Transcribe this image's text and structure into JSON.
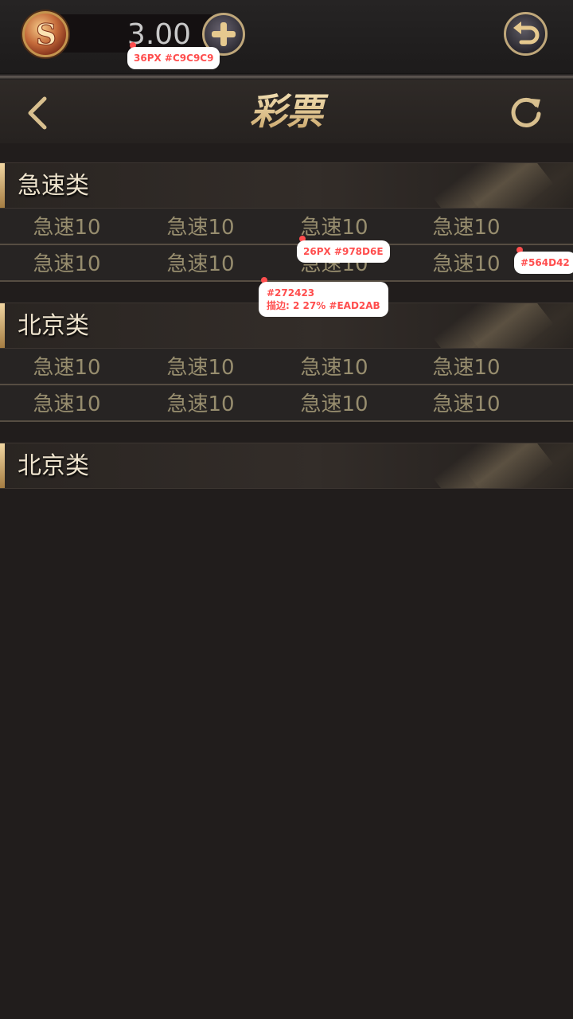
{
  "topbar": {
    "balance": "3.00",
    "coin_icon": "s-coin-icon",
    "add_icon": "plus-icon",
    "return_icon": "return-icon"
  },
  "header": {
    "title": "彩票",
    "back_icon": "chevron-left-icon",
    "refresh_icon": "refresh-icon"
  },
  "sections": [
    {
      "title": "急速类",
      "rows": [
        [
          "急速10",
          "急速10",
          "急速10",
          "急速10"
        ],
        [
          "急速10",
          "急速10",
          "急速10",
          "急速10"
        ]
      ]
    },
    {
      "title": "北京类",
      "rows": [
        [
          "急速10",
          "急速10",
          "急速10",
          "急速10"
        ],
        [
          "急速10",
          "急速10",
          "急速10",
          "急速10"
        ]
      ]
    },
    {
      "title": "北京类",
      "rows": []
    }
  ],
  "annotations": {
    "balance_spec": "36PX #C9C9C9",
    "cell_spec": "26PX #978D6E",
    "divider_spec": "#564D42",
    "row_bg_spec_line1": "#272423",
    "row_bg_spec_line2": "描边: 2 27% #EAD2AB"
  },
  "colors": {
    "page_bg": "#211d1c",
    "row_bg": "#272423",
    "divider": "#564d42",
    "cell_text": "#978d6e",
    "balance_text": "#c9c9c9",
    "accent_gold": "#e2c894"
  }
}
